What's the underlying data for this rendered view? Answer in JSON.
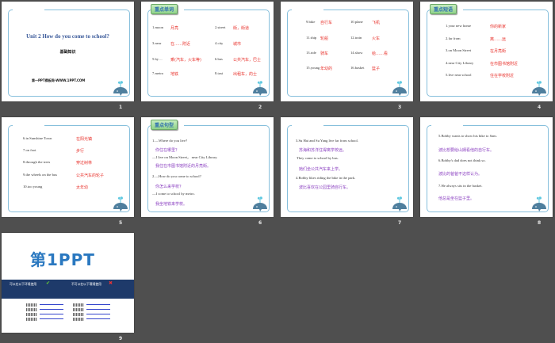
{
  "colors": {
    "accent_blue": "#3b5a9a",
    "red": "#e8302a",
    "purple": "#8a3fc0",
    "frame": "#86bfdc",
    "banner": "#1e3a6a"
  },
  "slides": [
    {
      "number": "1",
      "title": "Unit 2 How do you come to school?",
      "subtitle": "基础知识",
      "footer": "第一PPT模板网-WWW.1PPT.COM"
    },
    {
      "number": "2",
      "tag": "重点单词",
      "items": [
        {
          "en": "1.moon",
          "cn": "月亮"
        },
        {
          "en": "2.street",
          "cn": "街，街道"
        },
        {
          "en": "3.near",
          "cn": "在……附近"
        },
        {
          "en": "4.city",
          "cn": "城市"
        },
        {
          "en": "5.by ...",
          "cn": "乘(汽车，火车等)"
        },
        {
          "en": "6.bus",
          "cn": "公共汽车，巴士"
        },
        {
          "en": "7.metro",
          "cn": "地铁"
        },
        {
          "en": "8.taxi",
          "cn": "出租车，的士"
        }
      ]
    },
    {
      "number": "3",
      "items": [
        {
          "en": "9.bike",
          "cn": "自行车"
        },
        {
          "en": "10.plane",
          "cn": "飞机"
        },
        {
          "en": "11.ship",
          "cn": "轮船"
        },
        {
          "en": "12.train",
          "cn": "火车"
        },
        {
          "en": "13.ride",
          "cn": "骑车"
        },
        {
          "en": "14.show",
          "cn": "给……看"
        },
        {
          "en": "15.young",
          "cn": "年幼的"
        },
        {
          "en": "16.basket",
          "cn": "篮子"
        }
      ]
    },
    {
      "number": "4",
      "tag": "重点短语",
      "items": [
        {
          "en": "1.your new home",
          "cn": "你的新家"
        },
        {
          "en": "2.far from",
          "cn": "离……远"
        },
        {
          "en": "3.on Moon Street",
          "cn": "在月亮街"
        },
        {
          "en": "4.near City Library",
          "cn": "在市图书馆附近"
        },
        {
          "en": "5.live near school",
          "cn": "住在学校附近"
        }
      ]
    },
    {
      "number": "5",
      "items": [
        {
          "en": "6.in Sunshine Town",
          "cn": "在阳光镇"
        },
        {
          "en": "7.on foot",
          "cn": "步行"
        },
        {
          "en": "8.through the trees",
          "cn": "穿过树林"
        },
        {
          "en": "9.the wheels on the bus",
          "cn": "公共汽车的轮子"
        },
        {
          "en": "10.too young",
          "cn": "太年幼"
        }
      ]
    },
    {
      "number": "6",
      "tag": "重点句型",
      "lines": [
        {
          "text": "1.—Where do you live?",
          "style": "en"
        },
        {
          "text": "你住在哪里？",
          "style": "cn"
        },
        {
          "text": "—I live on Moon Street， near City Library.",
          "style": "en"
        },
        {
          "text": "我住在市图书馆附近的月亮街。",
          "style": "cn"
        },
        {
          "text": "2.—How do you come to school?",
          "style": "en"
        },
        {
          "text": "你怎么来学校？",
          "style": "cn"
        },
        {
          "text": "—I come to school by metro.",
          "style": "en"
        },
        {
          "text": "我坐地铁来学校。",
          "style": "cn"
        }
      ]
    },
    {
      "number": "7",
      "lines": [
        {
          "text": "3.Su Hai and Su Yang live far from school.",
          "style": "en"
        },
        {
          "text": "苏海和苏洋住得离学校远。",
          "style": "cn"
        },
        {
          "text": "They come to school by bus.",
          "style": "en"
        },
        {
          "text": "她们坐公共汽车来上学。",
          "style": "cn"
        },
        {
          "text": "4.Bobby likes riding the bike in the park.",
          "style": "en"
        },
        {
          "text": "波比喜欢在公园里骑自行车。",
          "style": "cn"
        }
      ]
    },
    {
      "number": "8",
      "lines": [
        {
          "text": "5.Bobby wants to show his bike to Sam.",
          "style": "en"
        },
        {
          "text": "波比想要给山姆看他的自行车。",
          "style": "cn"
        },
        {
          "text": "6.Bobby's dad does not think so.",
          "style": "en"
        },
        {
          "text": "波比的爸爸不这样认为。",
          "style": "cn"
        },
        {
          "text": "7.He always sits in the basket.",
          "style": "en"
        },
        {
          "text": "他总是坐在篮子里。",
          "style": "cn"
        }
      ]
    },
    {
      "number": "9",
      "logo": "第1PPT",
      "banner_left": "可以在以下环境使用",
      "banner_right": "不可以在以下環境使用"
    }
  ]
}
